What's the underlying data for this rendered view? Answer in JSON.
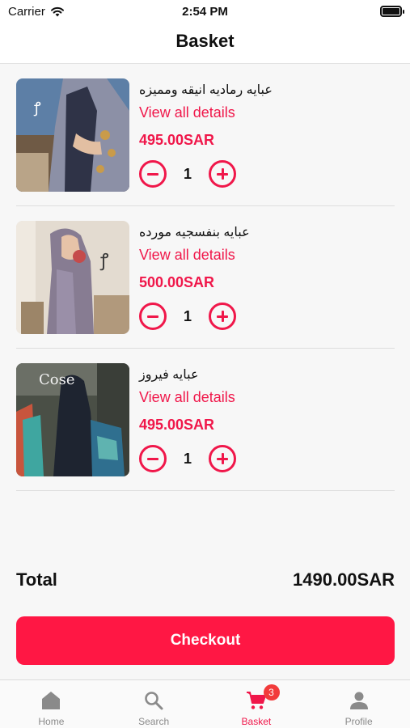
{
  "status_bar": {
    "carrier": "Carrier",
    "time": "2:54 PM"
  },
  "header": {
    "title": "Basket"
  },
  "cart": {
    "items": [
      {
        "name": "عبايه رماديه انيقه ومميزه",
        "details_link": "View all details",
        "price": "495.00SAR",
        "quantity": "1"
      },
      {
        "name": "عبايه بنفسجيه مورده",
        "details_link": "View all details",
        "price": "500.00SAR",
        "quantity": "1"
      },
      {
        "name": "عبايه فيروز",
        "details_link": "View all details",
        "price": "495.00SAR",
        "quantity": "1"
      }
    ]
  },
  "summary": {
    "total_label": "Total",
    "total_value": "1490.00SAR"
  },
  "checkout": {
    "label": "Checkout"
  },
  "tab_bar": {
    "tabs": [
      {
        "label": "Home",
        "icon": "home-icon"
      },
      {
        "label": "Search",
        "icon": "search-icon"
      },
      {
        "label": "Basket",
        "icon": "cart-icon",
        "badge": "3",
        "active": true
      },
      {
        "label": "Profile",
        "icon": "profile-icon"
      }
    ]
  },
  "colors": {
    "accent": "#f0174a",
    "checkout_bg": "#ff1744",
    "badge": "#f23b3b",
    "inactive_tab": "#8a8a8a"
  }
}
